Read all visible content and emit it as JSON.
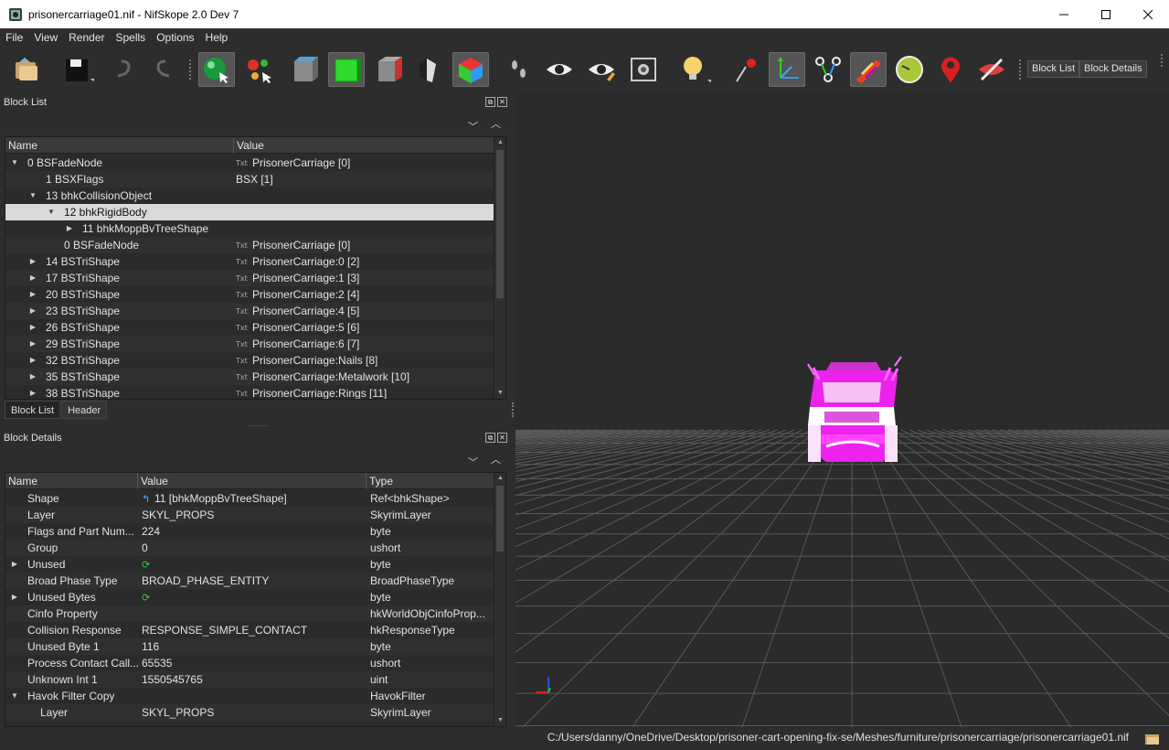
{
  "window": {
    "title": "prisonercarriage01.nif - NifSkope 2.0 Dev 7"
  },
  "menu": [
    "File",
    "View",
    "Render",
    "Spells",
    "Options",
    "Help"
  ],
  "toolbar": {
    "block_list_btn": "Block List",
    "block_details_btn": "Block Details"
  },
  "block_list": {
    "title": "Block List",
    "columns": [
      "Name",
      "Value"
    ],
    "rows": [
      {
        "name": "0 BSFadeNode",
        "value": "PrisonerCarriage [0]",
        "txt": true
      },
      {
        "name": "1 BSXFlags",
        "value": "BSX [1]",
        "txt": false
      },
      {
        "name": "13 bhkCollisionObject",
        "value": "",
        "txt": false
      },
      {
        "name": "12 bhkRigidBody",
        "value": "",
        "txt": false
      },
      {
        "name": "11 bhkMoppBvTreeShape",
        "value": "",
        "txt": false
      },
      {
        "name": "0 BSFadeNode",
        "value": "PrisonerCarriage [0]",
        "txt": true
      },
      {
        "name": "14 BSTriShape",
        "value": "PrisonerCarriage:0 [2]",
        "txt": true
      },
      {
        "name": "17 BSTriShape",
        "value": "PrisonerCarriage:1 [3]",
        "txt": true
      },
      {
        "name": "20 BSTriShape",
        "value": "PrisonerCarriage:2 [4]",
        "txt": true
      },
      {
        "name": "23 BSTriShape",
        "value": "PrisonerCarriage:4 [5]",
        "txt": true
      },
      {
        "name": "26 BSTriShape",
        "value": "PrisonerCarriage:5 [6]",
        "txt": true
      },
      {
        "name": "29 BSTriShape",
        "value": "PrisonerCarriage:6 [7]",
        "txt": true
      },
      {
        "name": "32 BSTriShape",
        "value": "PrisonerCarriage:Nails [8]",
        "txt": true
      },
      {
        "name": "35 BSTriShape",
        "value": "PrisonerCarriage:Metalwork [10]",
        "txt": true
      },
      {
        "name": "38 BSTriShape",
        "value": "PrisonerCarriage:Rings [11]",
        "txt": true
      }
    ],
    "tabs": [
      "Block List",
      "Header"
    ]
  },
  "block_details": {
    "title": "Block Details",
    "columns": [
      "Name",
      "Value",
      "Type"
    ],
    "rows": [
      {
        "name": "Shape",
        "value": "11 [bhkMoppBvTreeShape]",
        "type": "Ref<bhkShape>"
      },
      {
        "name": "Layer",
        "value": "SKYL_PROPS",
        "type": "SkyrimLayer"
      },
      {
        "name": "Flags and Part Num...",
        "value": "224",
        "type": "byte"
      },
      {
        "name": "Group",
        "value": "0",
        "type": "ushort"
      },
      {
        "name": "Unused",
        "value": "",
        "type": "byte"
      },
      {
        "name": "Broad Phase Type",
        "value": "BROAD_PHASE_ENTITY",
        "type": "BroadPhaseType"
      },
      {
        "name": "Unused Bytes",
        "value": "",
        "type": "byte"
      },
      {
        "name": "Cinfo Property",
        "value": "",
        "type": "hkWorldObjCinfoProp..."
      },
      {
        "name": "Collision Response",
        "value": "RESPONSE_SIMPLE_CONTACT",
        "type": "hkResponseType"
      },
      {
        "name": "Unused Byte 1",
        "value": "116",
        "type": "byte"
      },
      {
        "name": "Process Contact Call...",
        "value": "65535",
        "type": "ushort"
      },
      {
        "name": "Unknown Int 1",
        "value": "1550545765",
        "type": "uint"
      },
      {
        "name": "Havok Filter Copy",
        "value": "",
        "type": "HavokFilter"
      },
      {
        "name": "Layer",
        "value": "SKYL_PROPS",
        "type": "SkyrimLayer"
      }
    ]
  },
  "status": {
    "path": "C:/Users/danny/OneDrive/Desktop/prisoner-cart-opening-fix-se/Meshes/furniture/prisonercarriage/prisonercarriage01.nif"
  },
  "colors": {
    "accent_selection": "#d9d9d9",
    "model_color": "#ff33ff",
    "background": "#2d2d2d"
  }
}
